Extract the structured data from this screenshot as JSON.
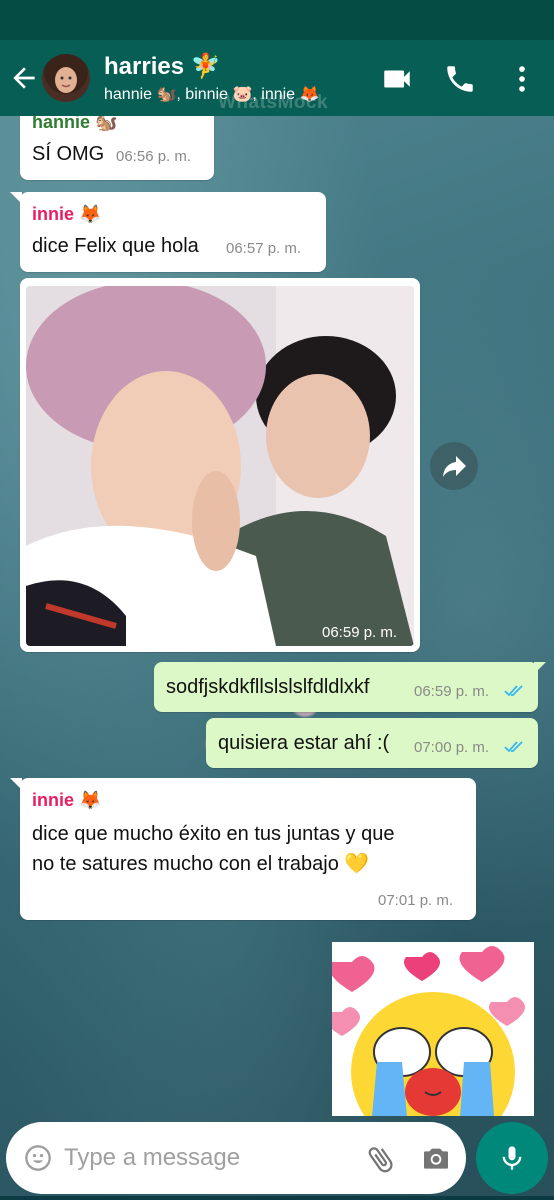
{
  "header": {
    "title": "harries 🧚",
    "subtitle": "hannie 🐿️, binnie 🐷, innie 🦊",
    "icons": [
      "back-arrow-icon",
      "video-call-icon",
      "phone-icon",
      "more-vert-icon"
    ]
  },
  "watermark": "WhatsMock",
  "messages": [
    {
      "direction": "in",
      "sender": "hannie 🐿️",
      "text": "SÍ OMG",
      "time": "06:56 p. m."
    },
    {
      "direction": "in",
      "sender": "innie 🦊",
      "text": "dice Felix que hola",
      "time": "06:57 p. m."
    },
    {
      "direction": "in",
      "type": "image",
      "time": "06:59 p. m."
    },
    {
      "direction": "out",
      "text": "sodfjskdkfllslslslfdldlxkf",
      "time": "06:59 p. m.",
      "status": "read"
    },
    {
      "direction": "out",
      "text": "quisiera estar ahí :(",
      "time": "07:00 p. m.",
      "status": "read"
    },
    {
      "direction": "in",
      "sender": "innie 🦊",
      "text_line1": "dice que mucho éxito en tus juntas y que",
      "text_line2": "no te satures mucho con el trabajo 💛",
      "time": "07:01 p. m."
    },
    {
      "direction": "out",
      "type": "sticker"
    }
  ],
  "input": {
    "placeholder": "Type a message"
  },
  "colors": {
    "header": "#075e54",
    "incoming_bubble": "#ffffff",
    "outgoing_bubble": "#dcf8c6",
    "read_ticks": "#34b7f1",
    "sender_hannie": "#2e7d32",
    "sender_innie": "#e91e63",
    "mic_button": "#00897b"
  }
}
